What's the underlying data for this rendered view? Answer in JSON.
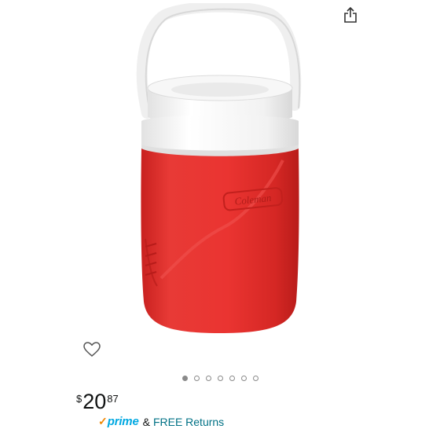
{
  "icons": {
    "share": "share-icon",
    "wishlist": "heart-outline-icon"
  },
  "product": {
    "brand_logo_text": "Coleman",
    "colors": {
      "body": "#e52d2a",
      "lid": "#f4f4f4"
    }
  },
  "carousel": {
    "count": 7,
    "active_index": 0
  },
  "price": {
    "symbol": "$",
    "whole": "20",
    "fraction": "87"
  },
  "delivery": {
    "prime_check": "✓",
    "prime_label": "prime",
    "connector": "&",
    "returns_label": "FREE Returns"
  },
  "colors": {
    "prime_blue": "#00a8e1",
    "prime_orange": "#f08804",
    "link": "#007185"
  }
}
